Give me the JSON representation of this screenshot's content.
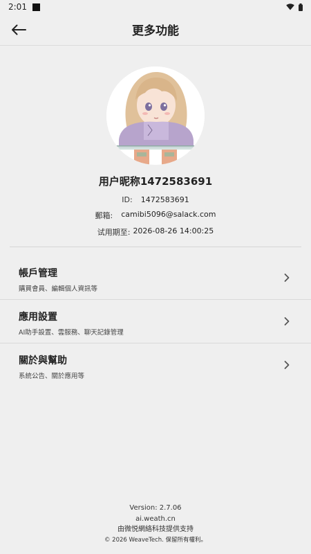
{
  "status_bar": {
    "time": "2:01",
    "icons": [
      "wifi-icon",
      "battery-icon"
    ]
  },
  "header": {
    "title": "更多功能",
    "back_icon": "arrow-left-icon"
  },
  "profile": {
    "nickname": "用户昵称1472583691",
    "id_label": "ID:",
    "id_value": "1472583691",
    "email_label": "郵箱:",
    "email_value": "camibi5096@salack.com",
    "trial_label": "试用期至:",
    "trial_value": "2026-08-26 14:00:25"
  },
  "menu": [
    {
      "title": "帳戶管理",
      "subtitle": "購買會員、編輯個人資訊等",
      "icon": "chevron-right-icon"
    },
    {
      "title": "應用設置",
      "subtitle": "AI助手設置、雲服務、聊天記錄管理",
      "icon": "chevron-right-icon"
    },
    {
      "title": "關於與幫助",
      "subtitle": "系統公告、關於應用等",
      "icon": "chevron-right-icon"
    }
  ],
  "footer": {
    "version": "Version: 2.7.06",
    "domain": "ai.weath.cn",
    "support": "由微悦網絡科技提供支持",
    "copyright": "© 2026 WeaveTech. 保留所有權利。"
  },
  "colors": {
    "background": "#efefef",
    "text": "#222222",
    "divider": "#d9d9d9"
  }
}
